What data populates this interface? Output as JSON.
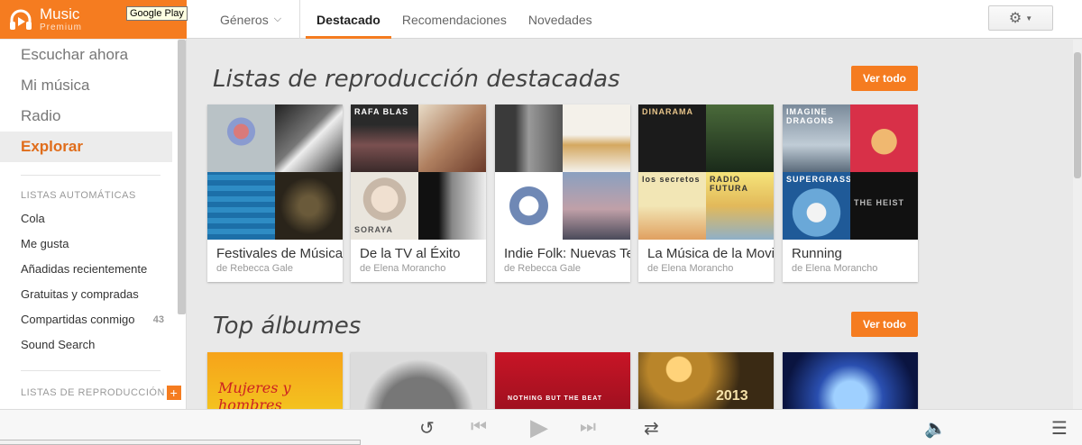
{
  "app": {
    "brand_title": "Music",
    "brand_subtitle": "Premium",
    "tooltip": "Google Play"
  },
  "nav": {
    "genres_label": "Géneros",
    "tabs": [
      "Destacado",
      "Recomendaciones",
      "Novedades"
    ],
    "active_tab": "Destacado"
  },
  "sidebar": {
    "main_items": [
      "Escuchar ahora",
      "Mi música",
      "Radio",
      "Explorar"
    ],
    "active_item": "Explorar",
    "auto_header": "LISTAS AUTOMÁTICAS",
    "auto_items": [
      {
        "label": "Cola",
        "count": ""
      },
      {
        "label": "Me gusta",
        "count": ""
      },
      {
        "label": "Añadidas recientemente",
        "count": ""
      },
      {
        "label": "Gratuitas y compradas",
        "count": ""
      },
      {
        "label": "Compartidas conmigo",
        "count": "43"
      },
      {
        "label": "Sound Search",
        "count": ""
      }
    ],
    "playlists_header": "LISTAS DE REPRODUCCIÓN",
    "add_symbol": "+"
  },
  "featured": {
    "title": "Listas de reproducción destacadas",
    "view_all": "Ver todo",
    "cards": [
      {
        "title": "Festivales de Música",
        "subtitle": "de Rebecca Gale",
        "tile_text": [
          "",
          "",
          "",
          ""
        ]
      },
      {
        "title": "De la TV al Éxito",
        "subtitle": "de Elena Morancho",
        "tile_text": [
          "RAFA BLAS",
          "",
          "SORAYA",
          ""
        ]
      },
      {
        "title": "Indie Folk: Nuevas Tendencias",
        "subtitle": "de Rebecca Gale",
        "tile_text": [
          "",
          "",
          "",
          ""
        ]
      },
      {
        "title": "La Música de la Movida",
        "subtitle": "de Elena Morancho",
        "tile_text": [
          "DINARAMA",
          "",
          "los secretos",
          "RADIO FUTURA"
        ]
      },
      {
        "title": "Running",
        "subtitle": "de Elena Morancho",
        "tile_text": [
          "IMAGINE DRAGONS",
          "",
          "SUPERGRASS",
          "THE HEIST"
        ]
      }
    ]
  },
  "top_albums": {
    "title": "Top álbumes",
    "view_all": "Ver todo",
    "albums": [
      {
        "label": "Mujeres y hombres"
      },
      {
        "label": ""
      },
      {
        "label": "NOTHING BUT THE BEAT"
      },
      {
        "label": "2013"
      },
      {
        "label": ""
      }
    ]
  },
  "colors": {
    "accent": "#f57c20",
    "active_text": "#e06d1b"
  },
  "icons": [
    "headphones-icon",
    "chevron-down-icon",
    "gear-icon",
    "repeat-icon",
    "previous-icon",
    "play-icon",
    "next-icon",
    "shuffle-icon",
    "volume-icon",
    "queue-icon"
  ]
}
